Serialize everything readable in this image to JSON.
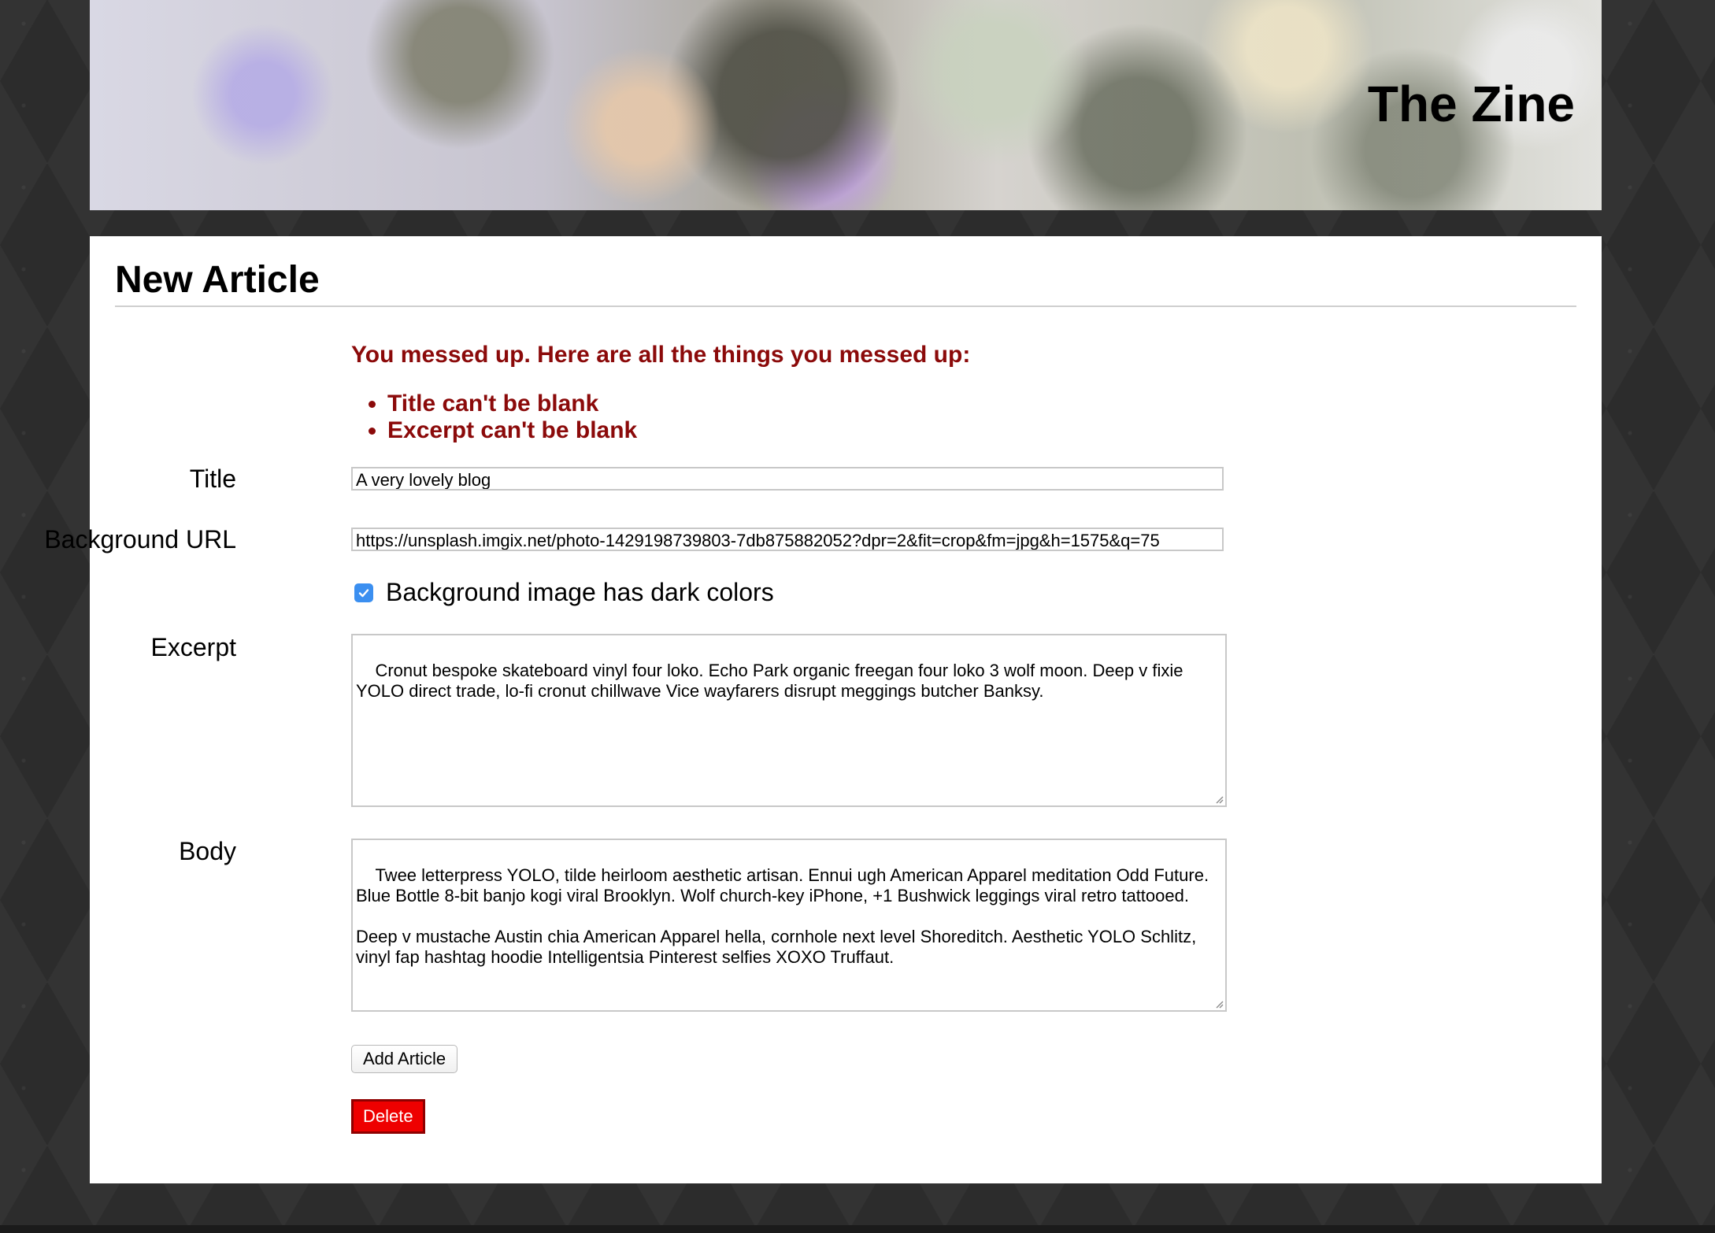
{
  "header": {
    "site_title": "The Zine"
  },
  "page": {
    "title": "New Article"
  },
  "errors": {
    "heading": "You messed up. Here are all the things you messed up:",
    "items": [
      "Title can't be blank",
      "Excerpt can't be blank"
    ]
  },
  "form": {
    "title": {
      "label": "Title",
      "value": "A very lovely blog"
    },
    "background_url": {
      "label": "Background URL",
      "value": "https://unsplash.imgix.net/photo-1429198739803-7db875882052?dpr=2&fit=crop&fm=jpg&h=1575&q=75"
    },
    "dark_colors": {
      "label": "Background image has dark colors",
      "checked": true
    },
    "excerpt": {
      "label": "Excerpt",
      "value": "Cronut bespoke skateboard vinyl four loko. Echo Park organic freegan four loko 3 wolf moon. Deep v fixie YOLO direct trade, lo-fi cronut chillwave Vice wayfarers disrupt meggings butcher Banksy."
    },
    "body": {
      "label": "Body",
      "value": "Twee letterpress YOLO, tilde heirloom aesthetic artisan. Ennui ugh American Apparel meditation Odd Future. Blue Bottle 8-bit banjo kogi viral Brooklyn. Wolf church-key iPhone, +1 Bushwick leggings viral retro tattooed.\n\nDeep v mustache Austin chia American Apparel hella, cornhole next level Shoreditch. Aesthetic YOLO Schlitz, vinyl fap hashtag hoodie Intelligentsia Pinterest selfies XOXO Truffaut."
    },
    "submit_label": "Add Article",
    "delete_label": "Delete"
  },
  "colors": {
    "error_text": "#8b0a0a",
    "delete_button": "#ee0000",
    "checkbox_accent": "#3b8ff0",
    "page_background": "#2c2c2c"
  }
}
